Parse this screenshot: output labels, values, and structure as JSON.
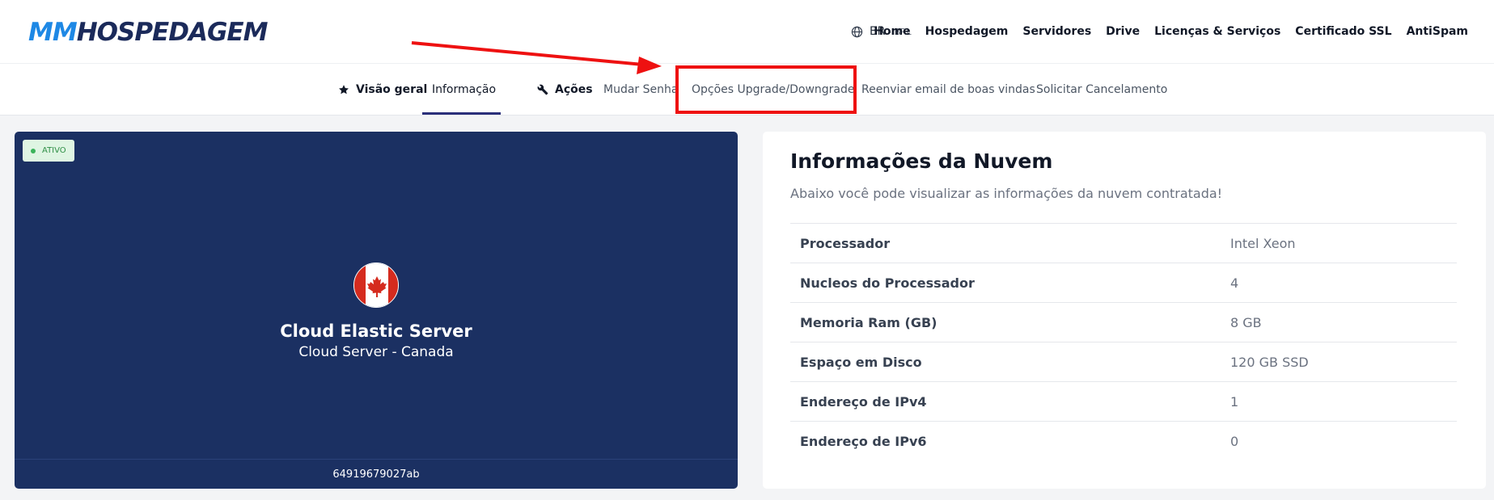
{
  "header": {
    "logo_prefix": "MM",
    "logo_rest": "HOSPEDAGEM",
    "language": {
      "code": "BR",
      "separator": " - ",
      "currency": "BRL"
    },
    "nav": [
      "Home",
      "Hospedagem",
      "Servidores",
      "Drive",
      "Licenças & Serviços",
      "Certificado SSL",
      "AntiSpam"
    ]
  },
  "subnav": {
    "overview": "Visão geral",
    "info": "Informação",
    "actions": "Ações",
    "change_password": "Mudar Senha",
    "upgrade_options": "Opções Upgrade/Downgrade",
    "resend_email": "Reenviar email de boas vindas",
    "request_cancel": "Solicitar Cancelamento"
  },
  "server": {
    "status": "ATIVO",
    "name": "Cloud Elastic Server",
    "subtitle": "Cloud Server - Canada",
    "id": "64919679027ab"
  },
  "info": {
    "title": "Informações da Nuvem",
    "subtitle": "Abaixo você pode visualizar as informações da nuvem contratada!",
    "rows": [
      {
        "label": "Processador",
        "value": "Intel Xeon"
      },
      {
        "label": "Nucleos do Processador",
        "value": "4"
      },
      {
        "label": "Memoria Ram (GB)",
        "value": "8 GB"
      },
      {
        "label": "Espaço em Disco",
        "value": "120 GB SSD"
      },
      {
        "label": "Endereço de IPv4",
        "value": "1"
      },
      {
        "label": "Endereço de IPv6",
        "value": "0"
      }
    ]
  },
  "colors": {
    "accent": "#1b3062",
    "highlight": "#ee1111",
    "status_green": "#3bb35b"
  }
}
